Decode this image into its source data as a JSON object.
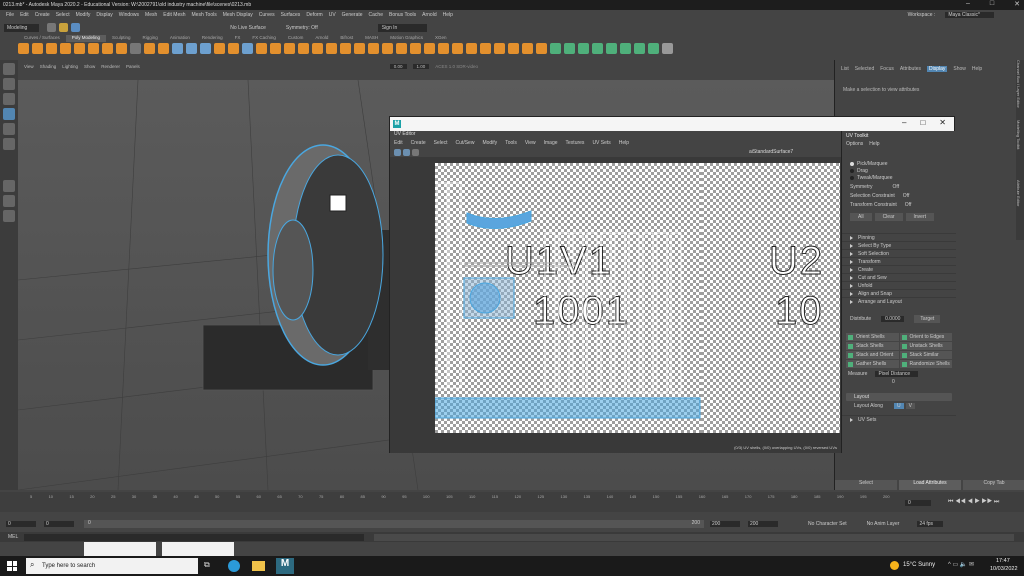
{
  "window": {
    "title": "0213.mb* - Autodesk Maya 2020.2 - Educational Version: W:\\2002791\\old industry machine\\file\\scenes\\0213.mb",
    "workspace_label": "Workspace :",
    "workspace_value": "Maya Classic*"
  },
  "menu": [
    "File",
    "Edit",
    "Create",
    "Select",
    "Modify",
    "Display",
    "Windows",
    "Mesh",
    "Edit Mesh",
    "Mesh Tools",
    "Mesh Display",
    "Curves",
    "Surfaces",
    "Deform",
    "UV",
    "Generate",
    "Cache",
    "Bonus Tools",
    "Arnold",
    "Help"
  ],
  "status": {
    "mode": "Modeling",
    "live_surface": "No Live Surface",
    "symmetry": "Symmetry: Off",
    "signin": "Sign In"
  },
  "shelf_tabs": [
    "Curves / Surfaces",
    "Poly Modeling",
    "Sculpting",
    "Rigging",
    "Animation",
    "Rendering",
    "FX",
    "FX Caching",
    "Custom",
    "Arnold",
    "Bifrost",
    "MASH",
    "Motion Graphics",
    "XGen"
  ],
  "shelf_active": "Poly Modeling",
  "viewport": {
    "menu": [
      "View",
      "Shading",
      "Lighting",
      "Show",
      "Renderer",
      "Panels"
    ],
    "camera": "persp",
    "near": "0.00",
    "far": "1.00",
    "colorspace": "ACES 1.0 SDR-video"
  },
  "attr": {
    "tabs": [
      "List",
      "Selected",
      "Focus",
      "Attributes",
      "Display",
      "Show",
      "Help"
    ],
    "active_tab": "Display",
    "message": "Make a selection to view attributes",
    "select": "Select",
    "load": "Load Attributes",
    "copy": "Copy Tab"
  },
  "side_tabs": [
    "Channel Box / Layer Editor",
    "Modelling Toolkit",
    "Attribute Editor"
  ],
  "uv_editor": {
    "title_sub": "UV Editor",
    "menu": [
      "Edit",
      "Create",
      "Select",
      "Cut/Sew",
      "Modify",
      "Tools",
      "View",
      "Image",
      "Textures",
      "UV Sets",
      "Help"
    ],
    "shader": "aiStandardSurface7",
    "tile1_top": "U1V1",
    "tile1_bottom": "1001",
    "tile2_top": "U2",
    "tile2_bottom": "10",
    "footer": "(0/3) UV shells, (0/0) overlapping UVs, (0/0) reversed UVs"
  },
  "uv_toolkit": {
    "title": "UV Toolkit",
    "menu": [
      "Options",
      "Help"
    ],
    "modes": [
      "Pick/Marquee",
      "Drag",
      "Tweak/Marquee"
    ],
    "symmetry_label": "Symmetry",
    "symmetry_value": "Off",
    "sel_constraint_label": "Selection Constraint",
    "sel_constraint_value": "Off",
    "xform_constraint_label": "Transform Constraint",
    "xform_constraint_value": "Off",
    "buttons": [
      "All",
      "Clear",
      "Invert"
    ],
    "sections": [
      "Pinning",
      "Select By Type",
      "Soft Selection",
      "Transform",
      "Create",
      "Cut and Sew",
      "Unfold",
      "Align and Snap",
      "Arrange and Layout"
    ],
    "distribute_label": "Distribute",
    "distribute_value": "0.0000",
    "target": "Target",
    "actions": [
      "Orient Shells",
      "Orient to Edges",
      "Stack Shells",
      "Unstack Shells",
      "Stack and Orient",
      "Stack Similar",
      "Gather Shells",
      "Randomize Shells"
    ],
    "measure_label": "Measure",
    "measure_value": "Pixel Distance",
    "measure_num": "0",
    "layout": "Layout",
    "layout_along": "Layout Along",
    "layout_u": "U",
    "layout_v": "V",
    "uv_sets": "UV Sets"
  },
  "timeline": {
    "ticks": [
      "5",
      "10",
      "15",
      "20",
      "25",
      "30",
      "35",
      "40",
      "45",
      "50",
      "55",
      "60",
      "65",
      "70",
      "75",
      "80",
      "85",
      "90",
      "95",
      "100",
      "105",
      "110",
      "115",
      "120",
      "125",
      "130",
      "135",
      "140",
      "145",
      "150",
      "155",
      "160",
      "165",
      "170",
      "175",
      "180",
      "185",
      "190",
      "195",
      "200"
    ],
    "current": "0"
  },
  "range": {
    "start": "0",
    "start2": "0",
    "inner_start": "0",
    "inner_end": "200",
    "end": "200",
    "end2": "200",
    "char_set": "No Character Set",
    "anim_layer": "No Anim Layer",
    "fps": "24 fps"
  },
  "mel": "MEL",
  "taskbar": {
    "search": "Type here to search",
    "weather": "15°C  Sunny",
    "time": "17:47",
    "date": "10/03/2022"
  }
}
